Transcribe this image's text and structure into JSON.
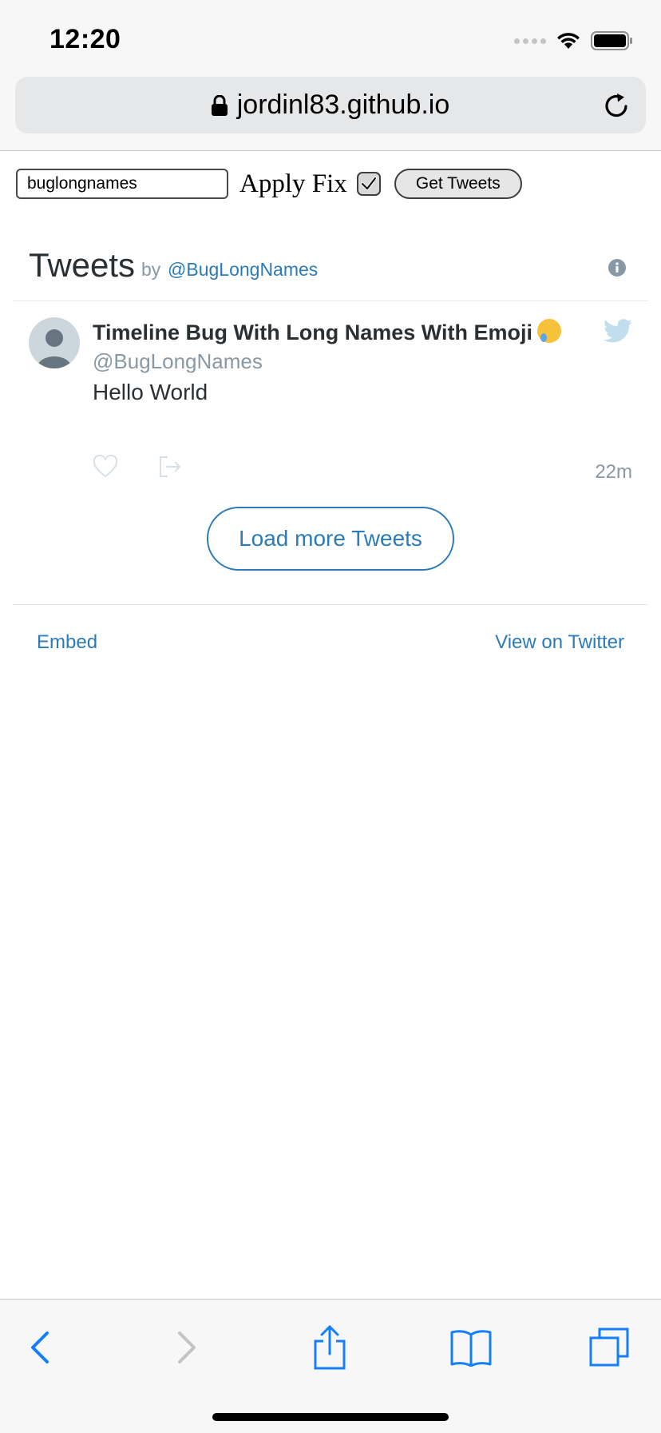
{
  "status_bar": {
    "time": "12:20"
  },
  "browser": {
    "url": "jordinl83.github.io"
  },
  "controls": {
    "handle_value": "buglongnames",
    "apply_fix_label": "Apply Fix",
    "apply_fix_checked": true,
    "get_tweets_label": "Get Tweets"
  },
  "timeline": {
    "title": "Tweets",
    "by_label": "by",
    "handle": "@BugLongNames",
    "tweet": {
      "name": "Timeline Bug With Long Names With Emoji",
      "handle": "@BugLongNames",
      "text": "Hello World",
      "time": "22m"
    },
    "load_more_label": "Load more Tweets",
    "embed_label": "Embed",
    "view_on_twitter_label": "View on Twitter"
  },
  "colors": {
    "link": "#2b7bb9",
    "muted": "#8899a6",
    "ios_blue": "#147efb"
  }
}
